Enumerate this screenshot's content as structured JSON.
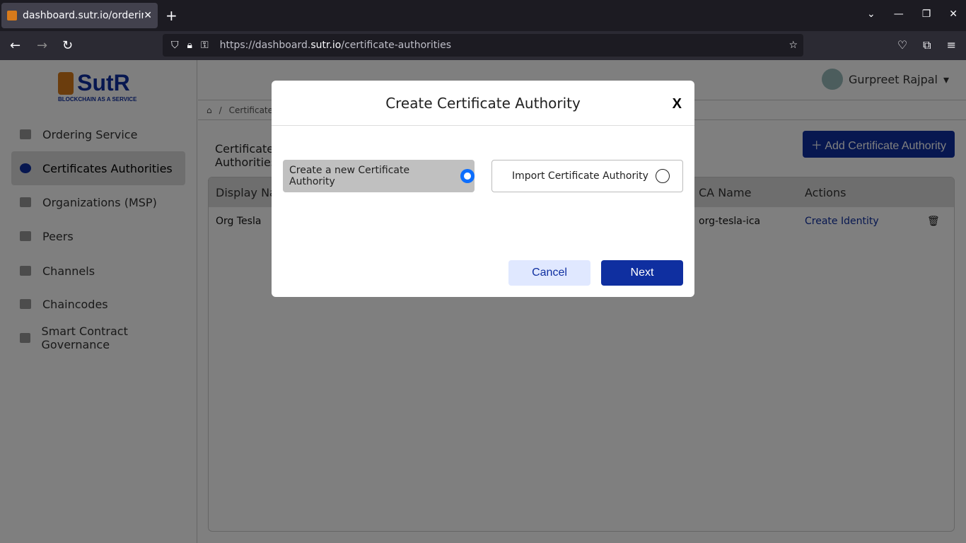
{
  "browser": {
    "tab_title": "dashboard.sutr.io/ordering",
    "url_prefix": "https://dashboard.",
    "url_domain": "sutr.io",
    "url_path": "/certificate-authorities"
  },
  "brand": {
    "name": "SutR",
    "tagline": "BLOCKCHAIN AS A SERVICE",
    "color": "#0f2fa0",
    "accent": "#d77a1b"
  },
  "sidebar": {
    "items": [
      {
        "label": "Ordering Service"
      },
      {
        "label": "Certificates Authorities",
        "active": true
      },
      {
        "label": "Organizations (MSP)"
      },
      {
        "label": "Peers"
      },
      {
        "label": "Channels"
      },
      {
        "label": "Chaincodes"
      },
      {
        "label": "Smart Contract Governance"
      }
    ]
  },
  "header": {
    "user": "Gurpreet Rajpal"
  },
  "breadcrumb": {
    "sep": "/",
    "current": "Certificate Authorities"
  },
  "page": {
    "tab": "Certificate Authorities",
    "add_button": "Add Certificate Authority"
  },
  "table": {
    "columns": [
      "Display Name",
      "CA Name",
      "Actions"
    ],
    "rows": [
      {
        "display_name": "Org Tesla",
        "ca_name": "org-tesla-ica",
        "action": "Create Identity"
      }
    ]
  },
  "modal": {
    "title": "Create Certificate Authority",
    "close": "X",
    "options": [
      {
        "label": "Create a new Certificate Authority",
        "selected": true
      },
      {
        "label": "Import Certificate Authority",
        "selected": false
      }
    ],
    "cancel": "Cancel",
    "next": "Next"
  }
}
